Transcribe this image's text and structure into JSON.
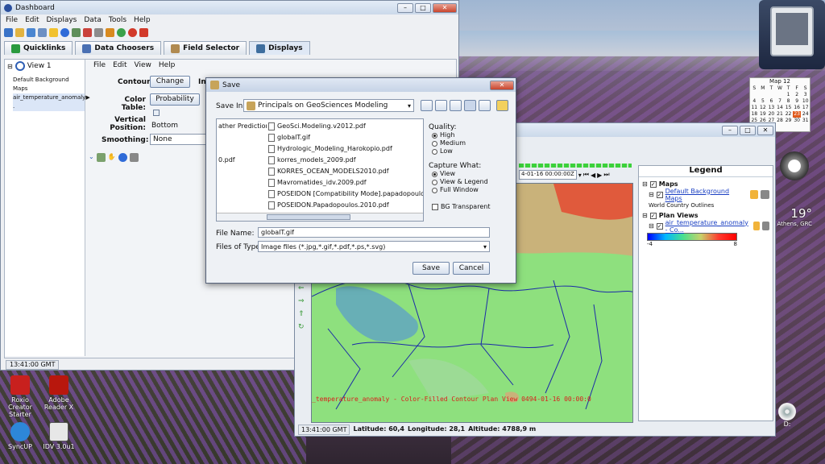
{
  "dashboard": {
    "title": "Dashboard",
    "menu": [
      "File",
      "Edit",
      "Displays",
      "Data",
      "Tools",
      "Help"
    ],
    "tabs": [
      "Quicklinks",
      "Data Choosers",
      "Field Selector",
      "Displays"
    ],
    "view_title": "View 1",
    "view_menu": [
      "File",
      "Edit",
      "View",
      "Help"
    ],
    "layers": [
      "Default Background Maps",
      "air_temperature_anomaly ."
    ],
    "contour_label": "Contour:",
    "contour_button": "Change",
    "contour_extra": "Int",
    "color_table_label": "Color Table:",
    "color_table_button": "Probability",
    "vertical_position_label": "Vertical Position:",
    "vertical_position_value": "Bottom",
    "smoothing_label": "Smoothing:",
    "smoothing_value": "None",
    "status_time": "13:41:00 GMT"
  },
  "save_dialog": {
    "title": "Save",
    "save_in_label": "Save In:",
    "save_in_value": "Principals on GeoSciences Modeling",
    "left_column": [
      "ather Prediction",
      "",
      "",
      "0.pdf"
    ],
    "files": [
      "GeoSci.Modeling.v2012.pdf",
      "globalT.gif",
      "Hydrologic_Modeling_Harokopio.pdf",
      "korres_models_2009.pdf",
      "KORRES_OCEAN_MODELS2010.pdf",
      "Mavromatides_idv.2009.pdf",
      "POSEIDON [Compatibility Mode].papadopoulos.pdf",
      "POSEIDON.Papadopoulos.2010.pdf"
    ],
    "quality_label": "Quality:",
    "quality_options": [
      "High",
      "Medium",
      "Low"
    ],
    "quality_selected": 0,
    "capture_label": "Capture What:",
    "capture_options": [
      "View",
      "View & Legend",
      "Full Window"
    ],
    "capture_selected": 0,
    "bg_transparent_label": "BG Transparent",
    "file_name_label": "File Name:",
    "file_name_value": "globalT.gif",
    "files_of_type_label": "Files of Type:",
    "files_of_type_value": "Image files (*.jpg,*.gif,*.pdf,*.ps,*.svg)",
    "save_button": "Save",
    "cancel_button": "Cancel"
  },
  "map_window": {
    "time_field": "4-01-16 00:00:00Z",
    "map_caption": "_temperature_anomaly - Color-Filled Contour Plan View 0494-01-16 00:00:0",
    "status_time": "13:41:00 GMT",
    "latitude": "Latitude: 60,4",
    "longitude": "Longitude: 28,1",
    "altitude": "Altitude: 4788,9 m",
    "legend_title": "Legend",
    "maps_section": "Maps",
    "maps_item": "Default Background Maps",
    "maps_sub": "World Country Outlines",
    "plan_views_section": "Plan Views",
    "plan_views_item": "air_temperature_anomaly - Co...",
    "colorbar_min": "-4",
    "colorbar_max": "8"
  },
  "gadgets": {
    "calendar_title": "Map 12",
    "calendar_days": [
      "S",
      "M",
      "T",
      "W",
      "T",
      "F",
      "S"
    ],
    "calendar_numbers": [
      "1",
      "2",
      "3",
      "4",
      "5",
      "6",
      "7",
      "8",
      "9",
      "10",
      "11",
      "12",
      "13",
      "14",
      "15",
      "16",
      "17",
      "18",
      "19",
      "20",
      "21",
      "22",
      "23",
      "24",
      "25",
      "26",
      "27",
      "28",
      "29",
      "30",
      "31"
    ],
    "calendar_today": "23",
    "weather_temp": "19°",
    "weather_city": "Athens, GRC",
    "drive_label": "D:"
  },
  "desktop_icons": [
    "Roxio Creator Starter",
    "Adobe Reader X",
    "SyncUP",
    "IDV 3.0u1"
  ],
  "colors": {
    "accent": "#2f6bd8",
    "map_green": "#8ee07e",
    "map_tan": "#c9b27a",
    "map_red": "#e05a3c",
    "map_blue": "#5fa3c4"
  }
}
